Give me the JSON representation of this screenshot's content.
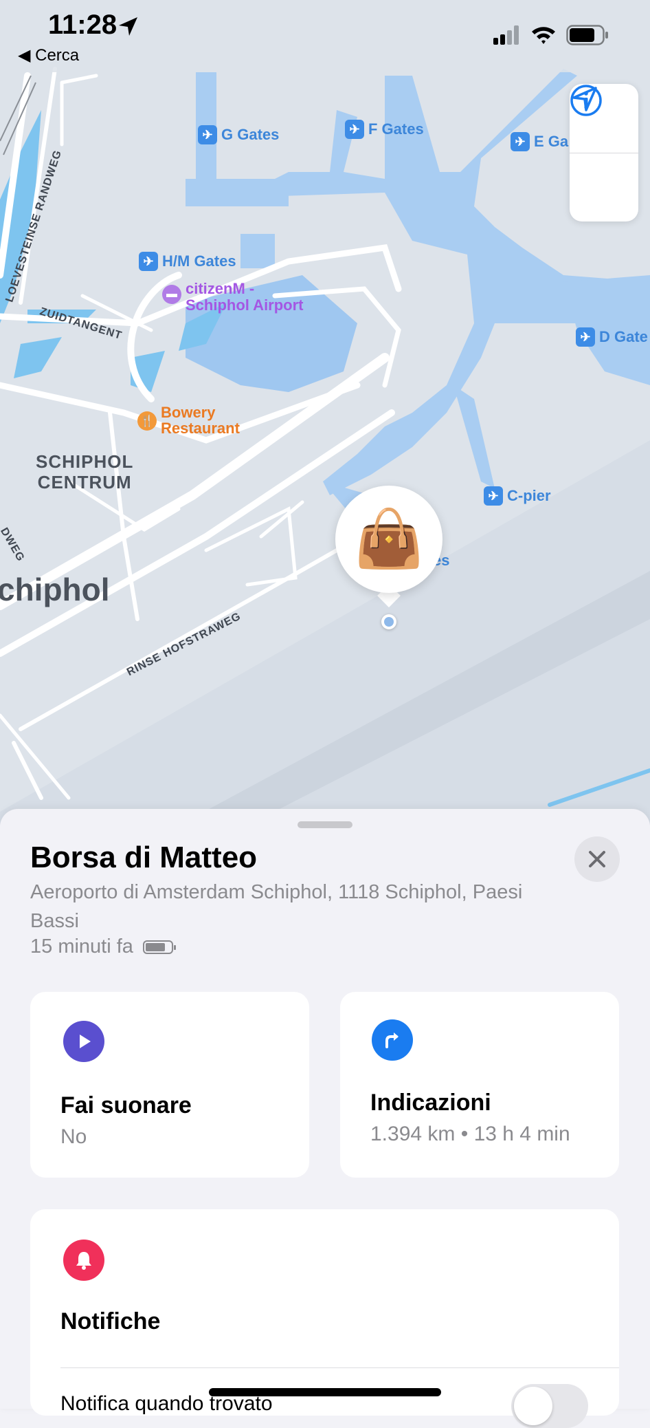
{
  "status_bar": {
    "time": "11:28",
    "back_label": "Cerca",
    "icons": [
      "location-arrow-icon",
      "cellular-signal-icon",
      "wifi-icon",
      "battery-icon"
    ]
  },
  "map": {
    "pois": [
      {
        "label": "G Gates",
        "kind": "airport-gate"
      },
      {
        "label": "F Gates",
        "kind": "airport-gate"
      },
      {
        "label": "E Ga",
        "kind": "airport-gate"
      },
      {
        "label": "H/M Gates",
        "kind": "airport-gate"
      },
      {
        "label": "D Gate",
        "kind": "airport-gate"
      },
      {
        "label": "C-pier",
        "kind": "airport-gate"
      },
      {
        "label": "es",
        "kind": "airport-gate"
      },
      {
        "label_line1": "citizenM -",
        "label_line2": "Schiphol Airport",
        "kind": "hotel"
      },
      {
        "label_line1": "Bowery",
        "label_line2": "Restaurant",
        "kind": "restaurant"
      }
    ],
    "areas": {
      "centrum_line1": "SCHIPHOL",
      "centrum_line2": "CENTRUM",
      "town": "chiphol"
    },
    "roads": [
      "LOEVESTEINSE RANDWEG",
      "ZUIDTANGENT",
      "RINSE HOFSTRAWEG",
      "DWEG"
    ],
    "controls": [
      "info-icon",
      "location-arrow-icon"
    ],
    "pin_emoji": "👜",
    "colors": {
      "land": "#dde3ea",
      "water": "#a9cdf2",
      "airport": "#9fc7f0",
      "road": "#ffffff"
    }
  },
  "sheet": {
    "title": "Borsa di Matteo",
    "address": "Aeroporto di Amsterdam Schiphol, 1118 Schiphol, Paesi Bassi",
    "updated": "15 minuti fa",
    "actions": [
      {
        "label": "Fai suonare",
        "sub": "No",
        "icon": "play-icon",
        "color": "#5a4fcf"
      },
      {
        "label": "Indicazioni",
        "sub": "1.394 km • 13 h 4 min",
        "icon": "turn-right-arrow-icon",
        "color": "#1a7cf0"
      }
    ],
    "notifications": {
      "icon": "bell-icon",
      "color": "#f0305a",
      "label": "Notifiche",
      "row_label": "Notifica quando trovato",
      "toggle_on": false
    }
  }
}
